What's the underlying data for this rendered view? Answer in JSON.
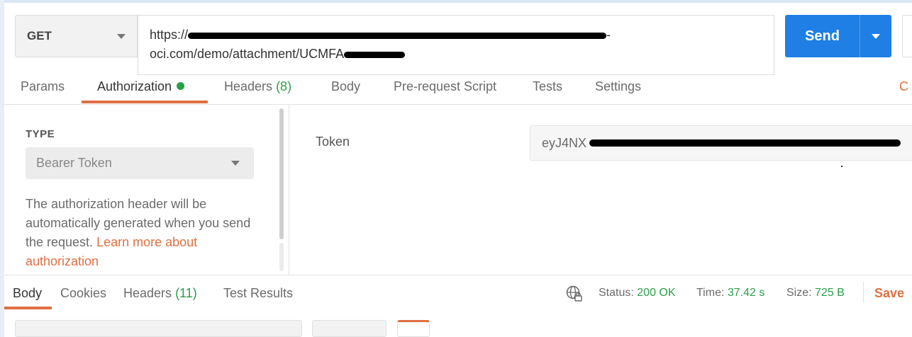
{
  "request": {
    "method": "GET",
    "url_line1_prefix": "https://",
    "url_line1_suffix": "-",
    "url_line2": "oci.com/demo/attachment/UCMFA",
    "send_label": "Send"
  },
  "tabs": [
    {
      "label": "Params"
    },
    {
      "label": "Authorization"
    },
    {
      "label": "Headers",
      "count": "(8)"
    },
    {
      "label": "Body"
    },
    {
      "label": "Pre-request Script"
    },
    {
      "label": "Tests"
    },
    {
      "label": "Settings"
    }
  ],
  "tabs_overflow_char": "C",
  "auth": {
    "type_label": "TYPE",
    "type_value": "Bearer Token",
    "desc_text": "The authorization header will be automatically generated when you send the request. ",
    "desc_link": "Learn more about authorization",
    "token_label": "Token",
    "token_value": "eyJ4NX"
  },
  "response": {
    "tabs": [
      {
        "label": "Body"
      },
      {
        "label": "Cookies"
      },
      {
        "label": "Headers",
        "count": "(11)"
      },
      {
        "label": "Test Results"
      }
    ],
    "status_label": "Status:",
    "status_value": "200 OK",
    "time_label": "Time:",
    "time_value": "37.42 s",
    "size_label": "Size:",
    "size_value": "725 B",
    "save_label": "Save"
  },
  "colors": {
    "accent": "#e06f41",
    "primary": "#1f7fe5",
    "success": "#2b9e4a"
  },
  "icons": {
    "method_caret": "chevron-down-icon",
    "send_caret": "chevron-down-icon",
    "auth_status": "green-dot-icon",
    "network": "globe-lock-icon"
  }
}
